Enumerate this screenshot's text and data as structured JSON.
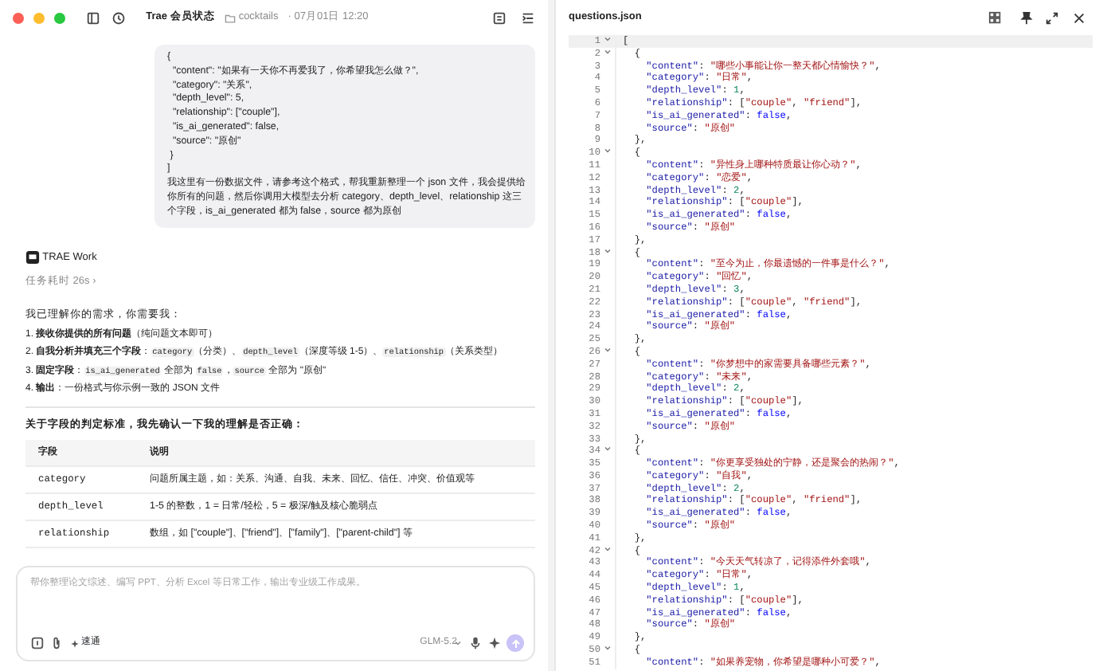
{
  "window": {
    "title": "Trae 会员状态",
    "folder": "cocktails",
    "timestamp": "· 07月01日 12:20"
  },
  "chat": {
    "user_message": {
      "code_lines": [
        "{",
        "  \"content\": \"如果有一天你不再爱我了，你希望我怎么做？\",",
        "  \"category\": \"关系\",",
        "  \"depth_level\": 5,",
        "  \"relationship\": [\"couple\"],",
        "  \"is_ai_generated\": false,",
        "  \"source\": \"原创\"",
        " }",
        "]"
      ],
      "text": "我这里有一份数据文件，请参考这个格式，帮我重新整理一个 json 文件，我会提供给你所有的问题，然后你调用大模型去分析 category、depth_level、relationship 这三个字段，is_ai_generated 都为 false，source 都为原创"
    },
    "assistant": {
      "name": "TRAE Work",
      "duration": "任务耗时 26s ›",
      "intro": "我已理解你的需求，你需要我：",
      "steps": [
        [
          {
            "text": "1. **接收你提供的所有问题**（纯问题文本即可）",
            "code": false
          }
        ],
        [
          {
            "text": "2. **自我分析并填充三个字段**：",
            "code": false
          },
          {
            "text": "category",
            "code": true
          },
          {
            "text": "（分类）、",
            "code": false
          },
          {
            "text": "depth_level",
            "code": true
          },
          {
            "text": "（深度等级 1-5）、",
            "code": false
          },
          {
            "text": "relationship",
            "code": true
          },
          {
            "text": "（关系类型）",
            "code": false
          }
        ],
        [
          {
            "text": "3. **固定字段**：",
            "code": false
          },
          {
            "text": "is_ai_generated",
            "code": true
          },
          {
            "text": " 全部为 ",
            "code": false
          },
          {
            "text": "false",
            "code": true
          },
          {
            "text": "，",
            "code": false
          },
          {
            "text": "source",
            "code": true
          },
          {
            "text": " 全部为 \"原创\"",
            "code": false
          }
        ],
        [
          {
            "text": "4. **输出**：一份格式与你示例一致的 JSON 文件",
            "code": false
          }
        ]
      ],
      "question": "关于字段的判定标准，我先确认一下我的理解是否正确：",
      "table": {
        "columns": [
          "字段",
          "说明"
        ],
        "rows": [
          [
            "category",
            "问题所属主题，如：关系、沟通、自我、未来、回忆、信任、冲突、价值观等"
          ],
          [
            "depth_level",
            "1-5 的整数，1 = 日常/轻松，5 = 极深/触及核心脆弱点"
          ],
          [
            "relationship",
            "数组，如 [\"couple\"]、[\"friend\"]、[\"family\"]、[\"parent-child\"] 等"
          ]
        ]
      }
    },
    "input": {
      "placeholder": "帮你整理论文综述、编写 PPT、分析 Excel 等日常工作，输出专业级工作成果。",
      "mode": "速通",
      "model": "GLM-5.2"
    }
  },
  "editor": {
    "filename": "questions.json",
    "lines": [
      {
        "n": "1",
        "text": "[",
        "fold": true,
        "current": true
      },
      {
        "n": "2",
        "text": "  {",
        "fold": true,
        "current": false
      },
      {
        "n": "3",
        "text": "    \"content\": \"哪些小事能让你一整天都心情愉快？\",",
        "fold": false,
        "current": false
      },
      {
        "n": "4",
        "text": "    \"category\": \"日常\",",
        "fold": false,
        "current": false
      },
      {
        "n": "5",
        "text": "    \"depth_level\": 1,",
        "fold": false,
        "current": false
      },
      {
        "n": "6",
        "text": "    \"relationship\": [\"couple\", \"friend\"],",
        "fold": false,
        "current": false
      },
      {
        "n": "7",
        "text": "    \"is_ai_generated\": false,",
        "fold": false,
        "current": false
      },
      {
        "n": "8",
        "text": "    \"source\": \"原创\"",
        "fold": false,
        "current": false
      },
      {
        "n": "9",
        "text": "  },",
        "fold": false,
        "current": false
      },
      {
        "n": "10",
        "text": "  {",
        "fold": true,
        "current": false
      },
      {
        "n": "11",
        "text": "    \"content\": \"异性身上哪种特质最让你心动？\",",
        "fold": false,
        "current": false
      },
      {
        "n": "12",
        "text": "    \"category\": \"恋爱\",",
        "fold": false,
        "current": false
      },
      {
        "n": "13",
        "text": "    \"depth_level\": 2,",
        "fold": false,
        "current": false
      },
      {
        "n": "14",
        "text": "    \"relationship\": [\"couple\"],",
        "fold": false,
        "current": false
      },
      {
        "n": "15",
        "text": "    \"is_ai_generated\": false,",
        "fold": false,
        "current": false
      },
      {
        "n": "16",
        "text": "    \"source\": \"原创\"",
        "fold": false,
        "current": false
      },
      {
        "n": "17",
        "text": "  },",
        "fold": false,
        "current": false
      },
      {
        "n": "18",
        "text": "  {",
        "fold": true,
        "current": false
      },
      {
        "n": "19",
        "text": "    \"content\": \"至今为止，你最遗憾的一件事是什么？\",",
        "fold": false,
        "current": false
      },
      {
        "n": "20",
        "text": "    \"category\": \"回忆\",",
        "fold": false,
        "current": false
      },
      {
        "n": "21",
        "text": "    \"depth_level\": 3,",
        "fold": false,
        "current": false
      },
      {
        "n": "22",
        "text": "    \"relationship\": [\"couple\", \"friend\"],",
        "fold": false,
        "current": false
      },
      {
        "n": "23",
        "text": "    \"is_ai_generated\": false,",
        "fold": false,
        "current": false
      },
      {
        "n": "24",
        "text": "    \"source\": \"原创\"",
        "fold": false,
        "current": false
      },
      {
        "n": "25",
        "text": "  },",
        "fold": false,
        "current": false
      },
      {
        "n": "26",
        "text": "  {",
        "fold": true,
        "current": false
      },
      {
        "n": "27",
        "text": "    \"content\": \"你梦想中的家需要具备哪些元素？\",",
        "fold": false,
        "current": false
      },
      {
        "n": "28",
        "text": "    \"category\": \"未来\",",
        "fold": false,
        "current": false
      },
      {
        "n": "29",
        "text": "    \"depth_level\": 2,",
        "fold": false,
        "current": false
      },
      {
        "n": "30",
        "text": "    \"relationship\": [\"couple\"],",
        "fold": false,
        "current": false
      },
      {
        "n": "31",
        "text": "    \"is_ai_generated\": false,",
        "fold": false,
        "current": false
      },
      {
        "n": "32",
        "text": "    \"source\": \"原创\"",
        "fold": false,
        "current": false
      },
      {
        "n": "33",
        "text": "  },",
        "fold": false,
        "current": false
      },
      {
        "n": "34",
        "text": "  {",
        "fold": true,
        "current": false
      },
      {
        "n": "35",
        "text": "    \"content\": \"你更享受独处的宁静，还是聚会的热闹？\",",
        "fold": false,
        "current": false
      },
      {
        "n": "36",
        "text": "    \"category\": \"自我\",",
        "fold": false,
        "current": false
      },
      {
        "n": "37",
        "text": "    \"depth_level\": 2,",
        "fold": false,
        "current": false
      },
      {
        "n": "38",
        "text": "    \"relationship\": [\"couple\", \"friend\"],",
        "fold": false,
        "current": false
      },
      {
        "n": "39",
        "text": "    \"is_ai_generated\": false,",
        "fold": false,
        "current": false
      },
      {
        "n": "40",
        "text": "    \"source\": \"原创\"",
        "fold": false,
        "current": false
      },
      {
        "n": "41",
        "text": "  },",
        "fold": false,
        "current": false
      },
      {
        "n": "42",
        "text": "  {",
        "fold": true,
        "current": false
      },
      {
        "n": "43",
        "text": "    \"content\": \"今天天气转凉了，记得添件外套哦\",",
        "fold": false,
        "current": false
      },
      {
        "n": "44",
        "text": "    \"category\": \"日常\",",
        "fold": false,
        "current": false
      },
      {
        "n": "45",
        "text": "    \"depth_level\": 1,",
        "fold": false,
        "current": false
      },
      {
        "n": "46",
        "text": "    \"relationship\": [\"couple\"],",
        "fold": false,
        "current": false
      },
      {
        "n": "47",
        "text": "    \"is_ai_generated\": false,",
        "fold": false,
        "current": false
      },
      {
        "n": "48",
        "text": "    \"source\": \"原创\"",
        "fold": false,
        "current": false
      },
      {
        "n": "49",
        "text": "  },",
        "fold": false,
        "current": false
      },
      {
        "n": "50",
        "text": "  {",
        "fold": true,
        "current": false
      },
      {
        "n": "51",
        "text": "    \"content\": \"如果养宠物，你希望是哪种小可爱？\",",
        "fold": false,
        "current": false
      }
    ]
  }
}
